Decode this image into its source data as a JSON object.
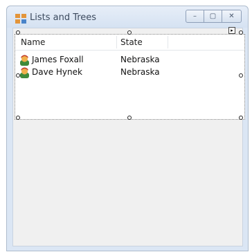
{
  "window": {
    "title": "Lists and Trees",
    "controls": {
      "minimize": "–",
      "maximize": "▢",
      "close": "✕"
    }
  },
  "listview": {
    "columns": [
      "Name",
      "State"
    ],
    "rows": [
      {
        "name": "James Foxall",
        "state": "Nebraska"
      },
      {
        "name": "Dave Hynek",
        "state": "Nebraska"
      }
    ]
  },
  "designer": {
    "smart_tag_glyph": "▸"
  },
  "colors": {
    "window_frame": "#dbe6f4",
    "client_bg": "#f0f0f0",
    "list_bg": "#ffffff"
  }
}
